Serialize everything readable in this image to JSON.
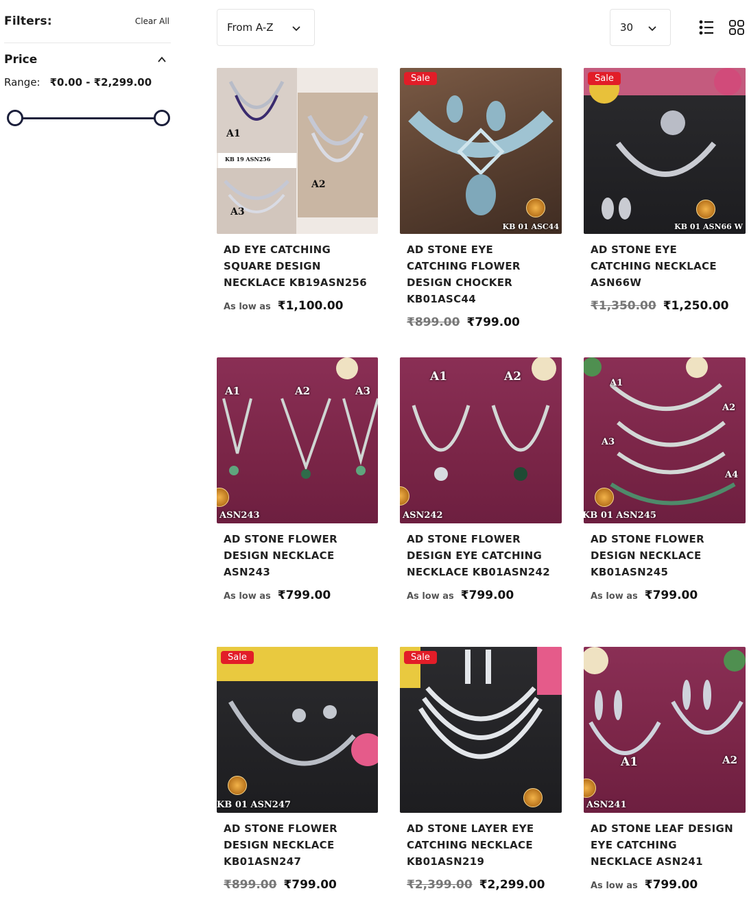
{
  "filters": {
    "title": "Filters:",
    "clear_label": "Clear All"
  },
  "price_filter": {
    "title": "Price",
    "range_label": "Range:",
    "range_value": "₹0.00 - ₹2,299.00",
    "min_fraction": 0,
    "max_fraction": 1
  },
  "toolbar": {
    "sort_value": "From A-Z",
    "per_page": "30"
  },
  "icons": {
    "chevron": "chevron-down-icon",
    "list_view": "list-view-icon",
    "grid_view": "grid-view-icon",
    "collapse": "chevron-up-icon"
  },
  "colors": {
    "accent": "#1b1f3b",
    "sale": "#e21d28"
  },
  "products": [
    {
      "name": "AD EYE CATCHING SQUARE DESIGN NECKLACE KB19ASN256",
      "sale": "",
      "low_as": "As low as",
      "old_price": "",
      "price": "₹1,100.00",
      "labels": [
        "A1",
        "A2",
        "A3"
      ],
      "code": "KB 19 ASN256"
    },
    {
      "name": "AD STONE EYE CATCHING FLOWER DESIGN CHOCKER KB01ASC44",
      "sale": "Sale",
      "low_as": "",
      "old_price": "₹899.00",
      "price": "₹799.00",
      "labels": [],
      "code": "KB 01 ASC44"
    },
    {
      "name": "AD STONE EYE CATCHING NECKLACE ASN66W",
      "sale": "Sale",
      "low_as": "",
      "old_price": "₹1,350.00",
      "price": "₹1,250.00",
      "labels": [],
      "code": "KB 01 ASN66 W"
    },
    {
      "name": "AD STONE FLOWER DESIGN NECKLACE ASN243",
      "sale": "",
      "low_as": "As low as",
      "old_price": "",
      "price": "₹799.00",
      "labels": [
        "A1",
        "A2",
        "A3"
      ],
      "code": "ASN243"
    },
    {
      "name": "AD STONE FLOWER DESIGN EYE CATCHING NECKLACE KB01ASN242",
      "sale": "",
      "low_as": "As low as",
      "old_price": "",
      "price": "₹799.00",
      "labels": [
        "A1",
        "A2"
      ],
      "code": "ASN242"
    },
    {
      "name": "AD STONE FLOWER DESIGN NECKLACE KB01ASN245",
      "sale": "",
      "low_as": "As low as",
      "old_price": "",
      "price": "₹799.00",
      "labels": [
        "A1",
        "A2",
        "A3",
        "A4"
      ],
      "code": "KB 01 ASN245"
    },
    {
      "name": "AD STONE FLOWER DESIGN NECKLACE KB01ASN247",
      "sale": "Sale",
      "low_as": "",
      "old_price": "₹899.00",
      "price": "₹799.00",
      "labels": [],
      "code": "KB 01 ASN247"
    },
    {
      "name": "AD STONE LAYER EYE CATCHING NECKLACE KB01ASN219",
      "sale": "Sale",
      "low_as": "",
      "old_price": "₹2,399.00",
      "price": "₹2,299.00",
      "labels": [],
      "code": ""
    },
    {
      "name": "AD STONE LEAF DESIGN EYE CATCHING NECKLACE ASN241",
      "sale": "",
      "low_as": "As low as",
      "old_price": "",
      "price": "₹799.00",
      "labels": [
        "A1",
        "A2"
      ],
      "code": "ASN241"
    }
  ]
}
